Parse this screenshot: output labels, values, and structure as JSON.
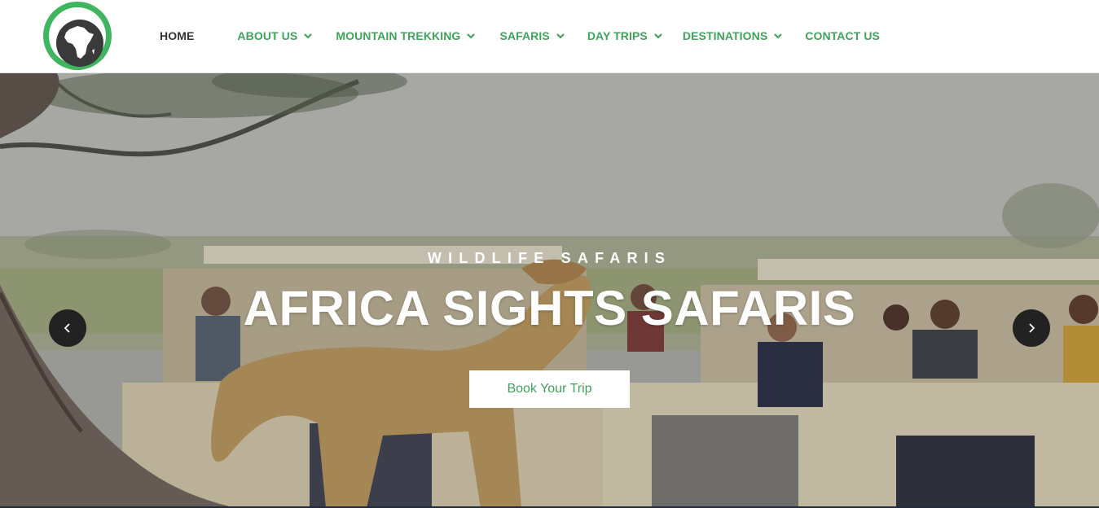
{
  "header": {
    "logo_icon": "africa-map-logo",
    "nav": [
      {
        "label": "HOME",
        "active": true,
        "dropdown": false
      },
      {
        "label": "ABOUT US",
        "active": false,
        "dropdown": true
      },
      {
        "label": "MOUNTAIN TREKKING",
        "active": false,
        "dropdown": true
      },
      {
        "label": "SAFARIS",
        "active": false,
        "dropdown": true
      },
      {
        "label": "DAY TRIPS",
        "active": false,
        "dropdown": true
      },
      {
        "label": "DESTINATIONS",
        "active": false,
        "dropdown": true
      },
      {
        "label": "CONTACT US",
        "active": false,
        "dropdown": false
      }
    ]
  },
  "hero": {
    "subtitle": "WILDLIFE SAFARIS",
    "title": "AFRICA SIGHTS SAFARIS",
    "button_label": "Book Your Trip",
    "prev_icon": "chevron-left-icon",
    "next_icon": "chevron-right-icon"
  },
  "colors": {
    "brand_green": "#3fa35b",
    "nav_active": "#333333",
    "arrow_bg": "#222222"
  }
}
